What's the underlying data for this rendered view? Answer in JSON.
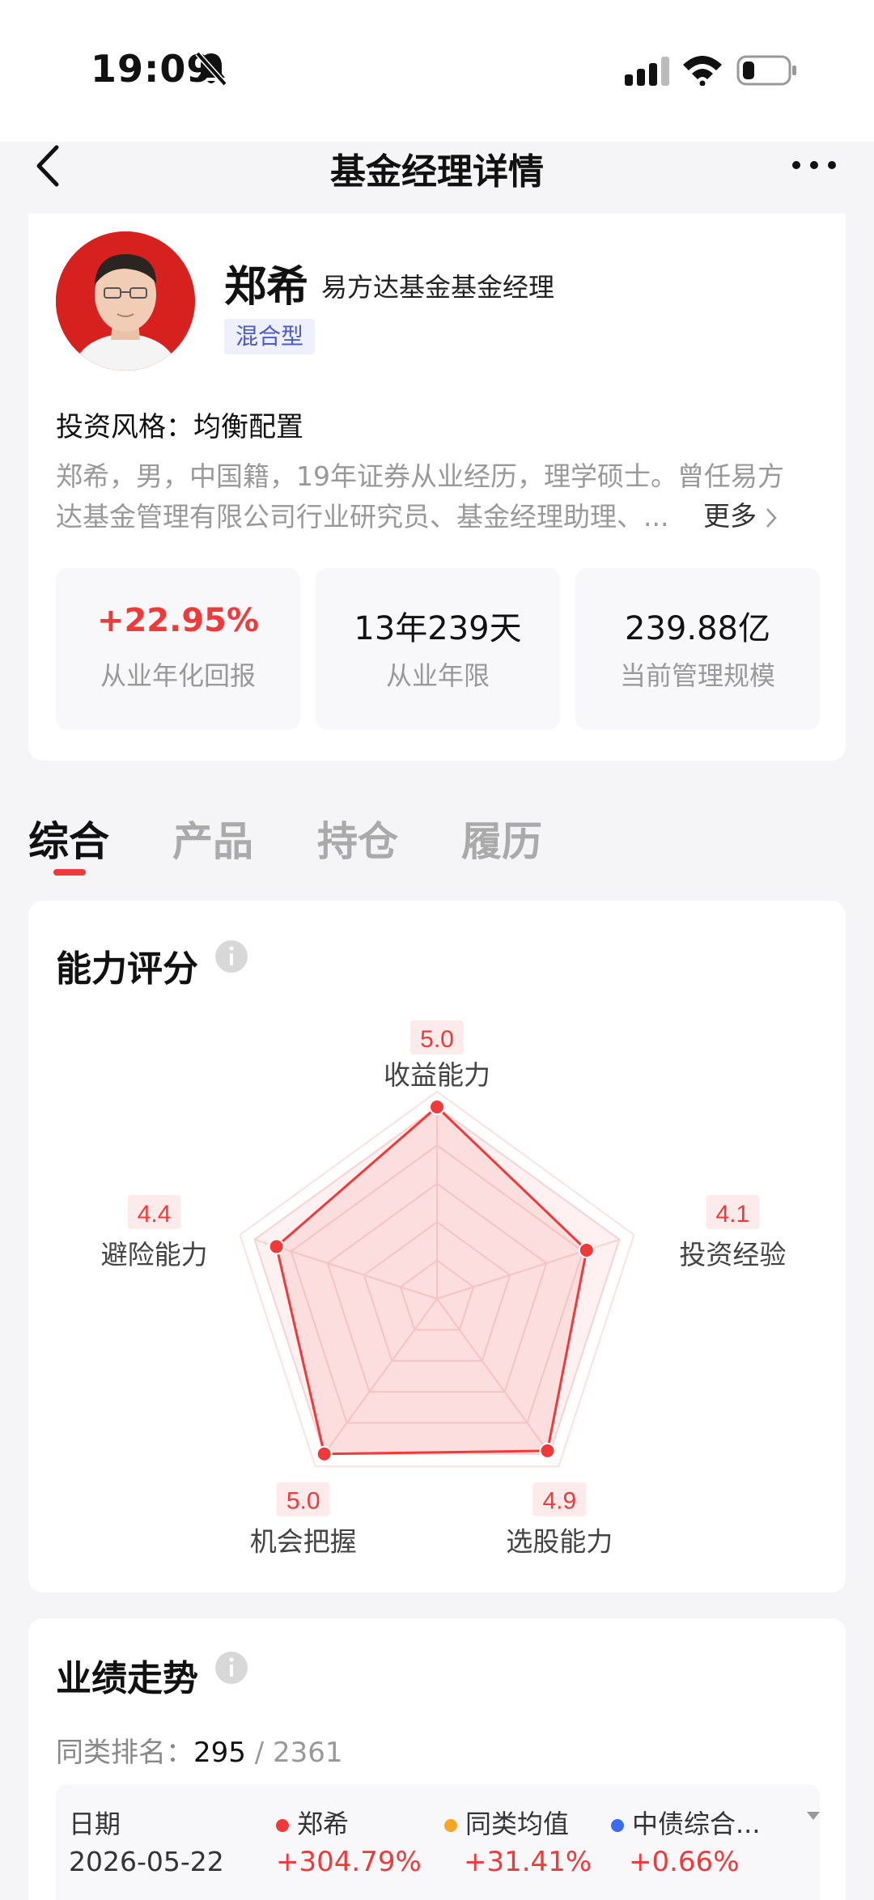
{
  "status_bar": {
    "time": "19:09"
  },
  "nav": {
    "title": "基金经理详情"
  },
  "profile": {
    "name": "郑希",
    "company": "易方达基金基金经理",
    "tag": "混合型",
    "style": "投资风格：均衡配置",
    "bio_line1": "郑希，男，中国籍，19年证券从业经历，理学硕士。曾任易方",
    "bio_line2": "达基金管理有限公司行业研究员、基金经理助理、...",
    "bio_more": "更多",
    "stats": [
      {
        "value": "+22.95%",
        "label": "从业年化回报"
      },
      {
        "value": "13年239天",
        "label": "从业年限"
      },
      {
        "value": "239.88亿",
        "label": "当前管理规模"
      }
    ]
  },
  "tabs": [
    "综合",
    "产品",
    "持仓",
    "履历"
  ],
  "ability": {
    "title": "能力评分",
    "accent": "#f03a3a"
  },
  "chart_data": {
    "type": "radar",
    "categories": [
      "收益能力",
      "投资经验",
      "选股能力",
      "机会把握",
      "避险能力"
    ],
    "values": [
      5.0,
      4.1,
      4.9,
      5.0,
      4.4
    ],
    "value_labels": [
      "5.0",
      "4.1",
      "4.9",
      "5.0",
      "4.4"
    ],
    "ylim": [
      0,
      5
    ]
  },
  "performance": {
    "title": "业绩走势",
    "rank_label": "同类排名：",
    "rank": "295",
    "rank_total": "2361",
    "date_label": "日期",
    "date_value": "2026-05-22",
    "legend": [
      {
        "name": "郑希",
        "value": "+304.79%",
        "color": "#f03a3a"
      },
      {
        "name": "同类均值",
        "value": "+31.41%",
        "color": "#f5a623"
      },
      {
        "name": "中债综合...",
        "value": "+0.66%",
        "color": "#3a6cf0"
      }
    ]
  }
}
